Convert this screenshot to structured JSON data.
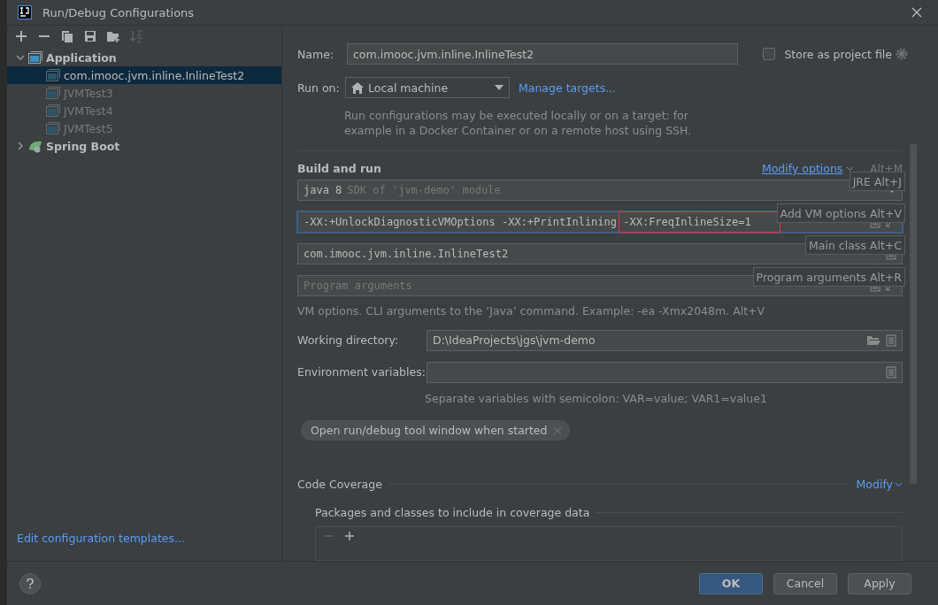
{
  "window": {
    "title": "Run/Debug Configurations"
  },
  "toolbar": [
    {
      "kind": "add",
      "disabled": false
    },
    {
      "kind": "remove",
      "disabled": false
    },
    {
      "kind": "copy",
      "disabled": false
    },
    {
      "kind": "save",
      "disabled": false
    },
    {
      "kind": "folder",
      "disabled": false
    },
    {
      "kind": "sort",
      "disabled": true
    }
  ],
  "tree": [
    {
      "label": "Application",
      "kind": "application",
      "expanded": true,
      "children": [
        {
          "label": "com.imooc.jvm.inline.InlineTest2",
          "selected": true,
          "temporary": false
        },
        {
          "label": "JVMTest3",
          "selected": false,
          "temporary": true
        },
        {
          "label": "JVMTest4",
          "selected": false,
          "temporary": true
        },
        {
          "label": "JVMTest5",
          "selected": false,
          "temporary": true
        }
      ]
    },
    {
      "label": "Spring Boot",
      "kind": "spring",
      "expanded": false
    }
  ],
  "templates_link": "Edit configuration templates...",
  "form": {
    "name_label": "Name:",
    "name_value": "com.imooc.jvm.inline.InlineTest2",
    "store": {
      "label": "Store as project file",
      "checked": false
    },
    "run_on_label": "Run on:",
    "run_on_value": "Local machine",
    "manage_link": "Manage targets...",
    "run_on_hint": "Run configurations may be executed locally or on a target: for example in a Docker Container or on a remote host using SSH.",
    "section": "Build and run",
    "modify_options": "Modify options",
    "modify_shortcut": "Alt+M",
    "jre": {
      "value": "java 8",
      "hint": "SDK of 'jvm-demo' module"
    },
    "vm_options": [
      {
        "text": "-XX:+UnlockDiagnosticVMOptions -XX:+PrintInlining ",
        "highlighted": false
      },
      {
        "text": "-XX:FreqInlineSize=1",
        "highlighted": true
      }
    ],
    "main_class": "com.imooc.jvm.inline.InlineTest2",
    "program_args_placeholder": "Program arguments",
    "vm_hint": "VM options. CLI arguments to the ‘Java’ command. Example: -ea -Xmx2048m. Alt+V",
    "working_dir_label": "Working directory:",
    "working_dir_value": "D:\\IdeaProjects\\jgs\\jvm-demo",
    "env_label": "Environment variables:",
    "env_hint": "Separate variables with semicolon: VAR=value; VAR1=value1",
    "chip": "Open run/debug tool window when started",
    "coverage_section": "Code Coverage",
    "coverage_modify": "Modify",
    "packages_label": "Packages and classes to include in coverage data"
  },
  "hints": [
    "JRE Alt+J",
    "Add VM options Alt+V",
    "Main class Alt+C",
    "Program arguments Alt+R"
  ],
  "buttons": [
    {
      "label": "OK",
      "kind": "primary"
    },
    {
      "label": "Cancel",
      "kind": "default"
    },
    {
      "label": "Apply",
      "kind": "default"
    }
  ]
}
